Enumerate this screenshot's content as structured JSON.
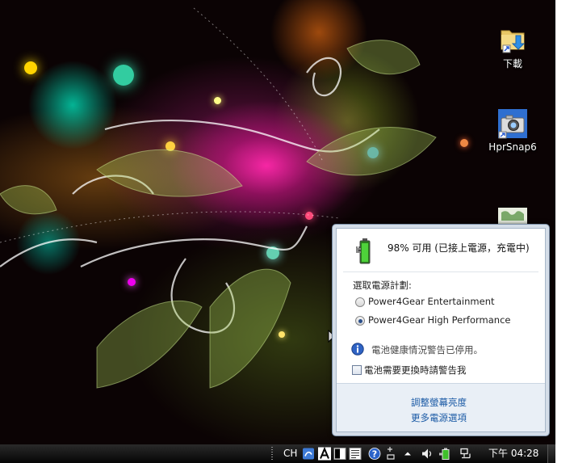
{
  "desktop": {
    "icons": [
      {
        "label": "下載",
        "icon": "downloads-folder-icon"
      },
      {
        "label": "HprSnap6",
        "icon": "camera-icon"
      },
      {
        "label": "",
        "icon": "map-icon"
      }
    ]
  },
  "flyout": {
    "status": "98% 可用 (已接上電源，充電中)",
    "plan_heading": "選取電源計劃:",
    "plans": [
      {
        "label": "Power4Gear Entertainment",
        "selected": false
      },
      {
        "label": "Power4Gear High Performance",
        "selected": true
      }
    ],
    "notice": "電池健康情況警告已停用。",
    "checkbox_label": "電池需要更換時請警告我",
    "links": {
      "brightness": "調整螢幕亮度",
      "more_options": "更多電源選項"
    }
  },
  "taskbar": {
    "language": "CH",
    "clock": "下午 04:28"
  },
  "colors": {
    "link": "#1a5aa5",
    "battery_green": "#3fbf2a",
    "flyout_footer": "#e9eff6"
  }
}
